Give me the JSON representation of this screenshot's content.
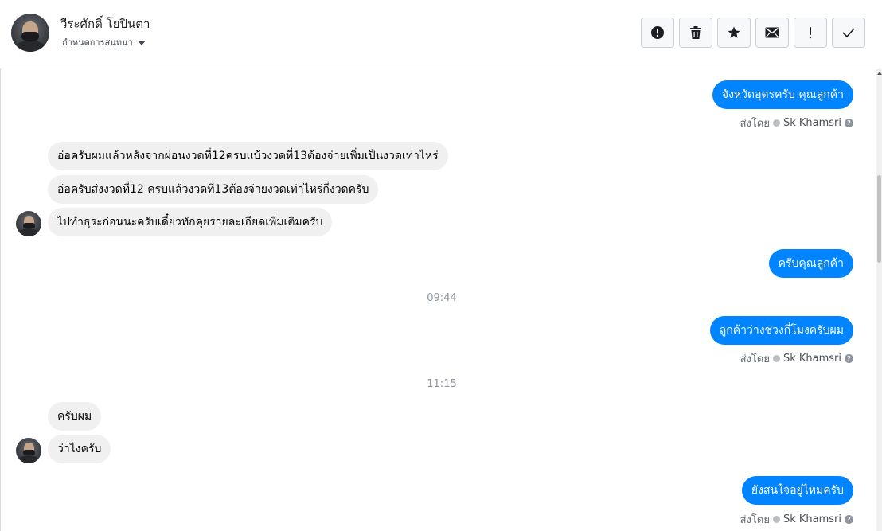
{
  "header": {
    "contact_name": "วีระศักดิ์ โยปินตา",
    "assign_label": "กำหนดการสนทนา",
    "actions": [
      {
        "name": "spam-button",
        "icon": "alert-circle-icon"
      },
      {
        "name": "delete-button",
        "icon": "trash-icon"
      },
      {
        "name": "star-button",
        "icon": "star-icon"
      },
      {
        "name": "mark-unread-button",
        "icon": "envelope-icon"
      },
      {
        "name": "follow-up-button",
        "icon": "exclamation-icon"
      },
      {
        "name": "mark-done-button",
        "icon": "check-icon"
      }
    ]
  },
  "thread": {
    "sent_by_prefix": "ส่งโดย",
    "agent_name": "Sk Khamsri",
    "messages": [
      {
        "dir": "out",
        "text": "จังหวัดอุดรครับ คุณลูกค้า",
        "sent_by": true
      },
      {
        "dir": "in",
        "text": "อ่อครับผมแล้วหลังจากผ่อนงวดที่12ครบแบ้วงวดที่13ต้องจ่ายเพิ่มเป็นงวดเท่าไหร่"
      },
      {
        "dir": "in",
        "text": "อ่อครับส่งงวดที่12  ครบแล้วงวดที่13ต้องจ่ายงวดเท่าไหร่กี่งวดครับ"
      },
      {
        "dir": "in",
        "text": "ไปทำธุระก่อนนะครับเดี๋ยวทักคุยรายละเอียดเพิ่มเติมครับ",
        "avatar": true
      },
      {
        "dir": "out",
        "text": "ครับคุณลูกค้า"
      },
      {
        "dir": "out",
        "text": "ลูกค้าว่างช่วงกี่โมงครับผม",
        "sent_by": true
      },
      {
        "dir": "in",
        "text": "ครับผม"
      },
      {
        "dir": "in",
        "text": "ว่าไงครับ",
        "avatar": true
      },
      {
        "dir": "out",
        "text": "ยังสนใจอยู่ไหมครับ",
        "sent_by": true
      }
    ],
    "timestamps": [
      "09:44",
      "11:15"
    ]
  },
  "colors": {
    "outgoing_bubble": "#0084ff",
    "incoming_bubble": "#f0f0f0",
    "timestamp": "#8d949e"
  }
}
